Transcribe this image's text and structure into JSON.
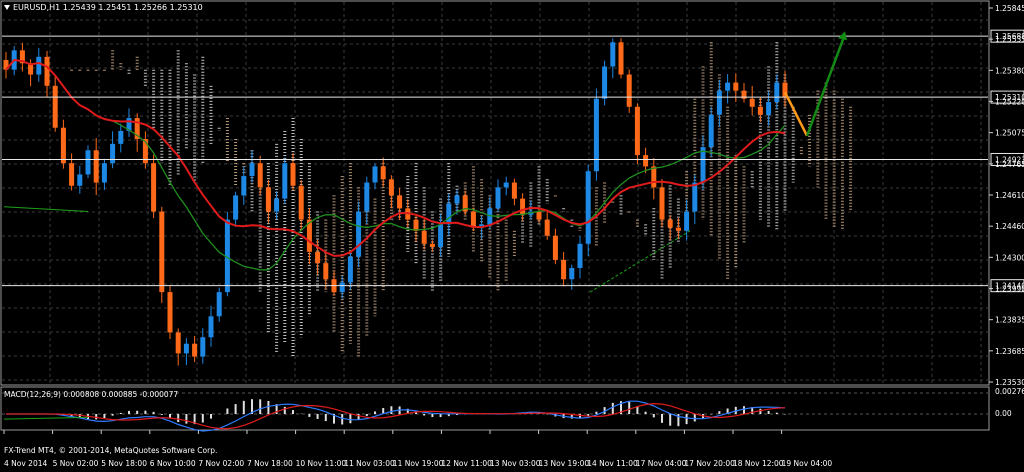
{
  "header": {
    "symbol_info": "EURUSD,H1  1.25439 1.25451 1.25266 1.25310"
  },
  "macd_header": "MACD(12,26,9) 0.000808 0.000885 -0.000077",
  "copyright": "FX-Trend MT4, © 2001-2014, MetaQuotes Software Corp.",
  "colors": {
    "bull": "#1e88e5",
    "bear": "#ff6a1a",
    "grid": "#3a3a3a",
    "ma_red": "#e01b1b",
    "ma_green": "#1f8f1f",
    "arrow_green": "#138a13",
    "arrow_orange": "#ff9a1a"
  },
  "price_axis": {
    "labels": [
      "1.25845",
      "1.25535",
      "1.25380",
      "1.25220",
      "1.25075",
      "1.24765",
      "1.24610",
      "1.24460",
      "1.24300",
      "1.23990",
      "1.23835",
      "1.23685",
      "1.23530"
    ],
    "highlighted": [
      {
        "value": "1.25688",
        "price": 1.25688
      },
      {
        "value": "1.25310",
        "price": 1.2531
      },
      {
        "value": "1.24923",
        "price": 1.24923
      },
      {
        "value": "1.24140",
        "price": 1.2414
      }
    ]
  },
  "macd_axis": {
    "labels": [
      "0.00276",
      "0.00"
    ]
  },
  "time_axis": {
    "labels": [
      "4 Nov 2014",
      "5 Nov 02:00",
      "5 Nov 18:00",
      "6 Nov 10:00",
      "7 Nov 02:00",
      "7 Nov 18:00",
      "10 Nov 11:00",
      "11 Nov 03:00",
      "11 Nov 19:00",
      "12 Nov 11:00",
      "13 Nov 03:00",
      "13 Nov 19:00",
      "14 Nov 11:00",
      "17 Nov 04:00",
      "17 Nov 20:00",
      "18 Nov 12:00",
      "19 Nov 04:00"
    ]
  },
  "chart_data": {
    "type": "candlestick",
    "symbol": "EURUSD",
    "timeframe": "H1",
    "last": {
      "open": 1.25439,
      "high": 1.25451,
      "low": 1.25266,
      "close": 1.2531
    },
    "ylim": [
      1.2353,
      1.259
    ],
    "horizontal_levels": [
      1.25688,
      1.2531,
      1.24923,
      1.2414
    ],
    "close_path": [
      1.2548,
      1.256,
      1.2552,
      1.2545,
      1.2556,
      1.2538,
      1.2512,
      1.249,
      1.2476,
      1.2483,
      1.2498,
      1.2478,
      1.249,
      1.2502,
      1.251,
      1.2518,
      1.2505,
      1.249,
      1.246,
      1.241,
      1.2385,
      1.2372,
      1.2378,
      1.237,
      1.2382,
      1.2395,
      1.241,
      1.2455,
      1.247,
      1.2482,
      1.249,
      1.2475,
      1.246,
      1.2468,
      1.249,
      1.2476,
      1.2455,
      1.2435,
      1.2428,
      1.2418,
      1.241,
      1.2416,
      1.2432,
      1.246,
      1.2478,
      1.2488,
      1.248,
      1.247,
      1.2462,
      1.2455,
      1.2448,
      1.244,
      1.2438,
      1.2452,
      1.2465,
      1.247,
      1.246,
      1.245,
      1.2452,
      1.2462,
      1.2475,
      1.2478,
      1.2468,
      1.2458,
      1.246,
      1.2455,
      1.2445,
      1.243,
      1.2418,
      1.2425,
      1.244,
      1.2485,
      1.253,
      1.255,
      1.2565,
      1.2545,
      1.2525,
      1.2495,
      1.2488,
      1.2475,
      1.2455,
      1.245,
      1.2448,
      1.246,
      1.2478,
      1.25,
      1.252,
      1.2535,
      1.254,
      1.2535,
      1.253,
      1.2525,
      1.252,
      1.2528,
      1.254,
      1.2531
    ],
    "projection": {
      "down_to": 1.2507,
      "up_to": 1.257
    },
    "macd": {
      "main": 0.000808,
      "signal": 0.000885,
      "hist": -7.7e-05
    }
  }
}
